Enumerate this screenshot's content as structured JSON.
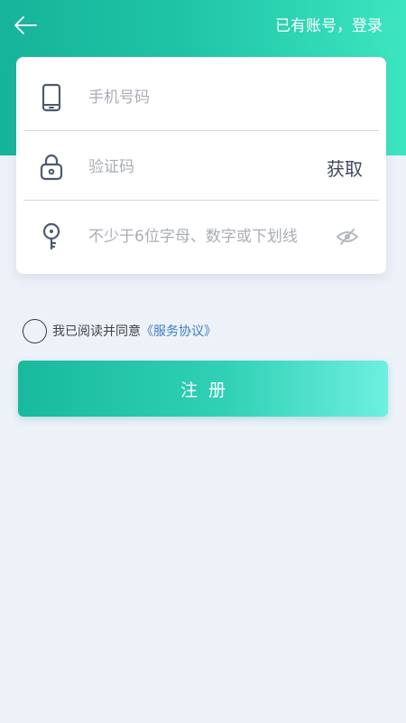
{
  "header": {
    "back_icon": "arrow-left-icon",
    "login_link": "已有账号，登录"
  },
  "form": {
    "phone": {
      "icon": "phone-icon",
      "placeholder": "手机号码",
      "value": ""
    },
    "code": {
      "icon": "lock-icon",
      "placeholder": "验证码",
      "value": "",
      "get_code_label": "获取"
    },
    "password": {
      "icon": "key-icon",
      "placeholder": "不少于6位字母、数字或下划线",
      "value": "",
      "visibility_icon": "eye-slash-icon"
    }
  },
  "agreement": {
    "checked": false,
    "text": "我已阅读并同意",
    "link": "《服务协议》"
  },
  "register_button": "注册",
  "colors": {
    "accent": "#1fc4a6",
    "accent_light": "#6eefdf",
    "background": "#edf1f8",
    "link": "#3f7fc4"
  }
}
